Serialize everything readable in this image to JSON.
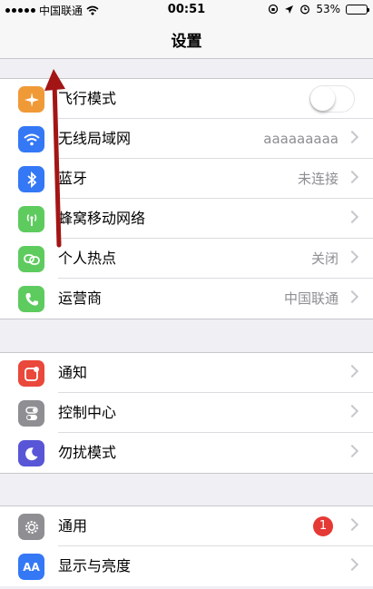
{
  "status_bar": {
    "carrier": "中国联通",
    "time": "00:51",
    "battery_text": "53%",
    "battery_level": 0.53
  },
  "nav": {
    "title": "设置"
  },
  "colors": {
    "airplane": "#f09a37",
    "wifi": "#3478f6",
    "bluetooth": "#3478f6",
    "cellular": "#5ecb5e",
    "hotspot": "#5ecb5e",
    "carrier": "#5ecb5e",
    "notifications": "#e9483b",
    "control_center": "#8e8e93",
    "dnd": "#5856d6",
    "general": "#8e8e93",
    "display": "#3478f6",
    "badge": "#e53935",
    "annotation_arrow": "#a31515"
  },
  "group1": {
    "airplane": {
      "label": "飞行模式",
      "icon": "airplane-icon",
      "toggle_on": false
    },
    "wifi": {
      "label": "无线局域网",
      "value": "aaaaaaaaa",
      "icon": "wifi-icon"
    },
    "bluetooth": {
      "label": "蓝牙",
      "value": "未连接",
      "icon": "bluetooth-icon"
    },
    "cellular": {
      "label": "蜂窝移动网络",
      "icon": "antenna-icon"
    },
    "hotspot": {
      "label": "个人热点",
      "value": "关闭",
      "icon": "link-icon"
    },
    "carrier": {
      "label": "运营商",
      "value": "中国联通",
      "icon": "phone-icon"
    }
  },
  "group2": {
    "notifications": {
      "label": "通知",
      "icon": "notification-icon"
    },
    "control_center": {
      "label": "控制中心",
      "icon": "switches-icon"
    },
    "dnd": {
      "label": "勿扰模式",
      "icon": "moon-icon"
    }
  },
  "group3": {
    "general": {
      "label": "通用",
      "badge": "1",
      "icon": "gear-icon"
    },
    "display": {
      "label": "显示与亮度",
      "icon_text": "AA",
      "icon": "text-size-icon"
    }
  }
}
